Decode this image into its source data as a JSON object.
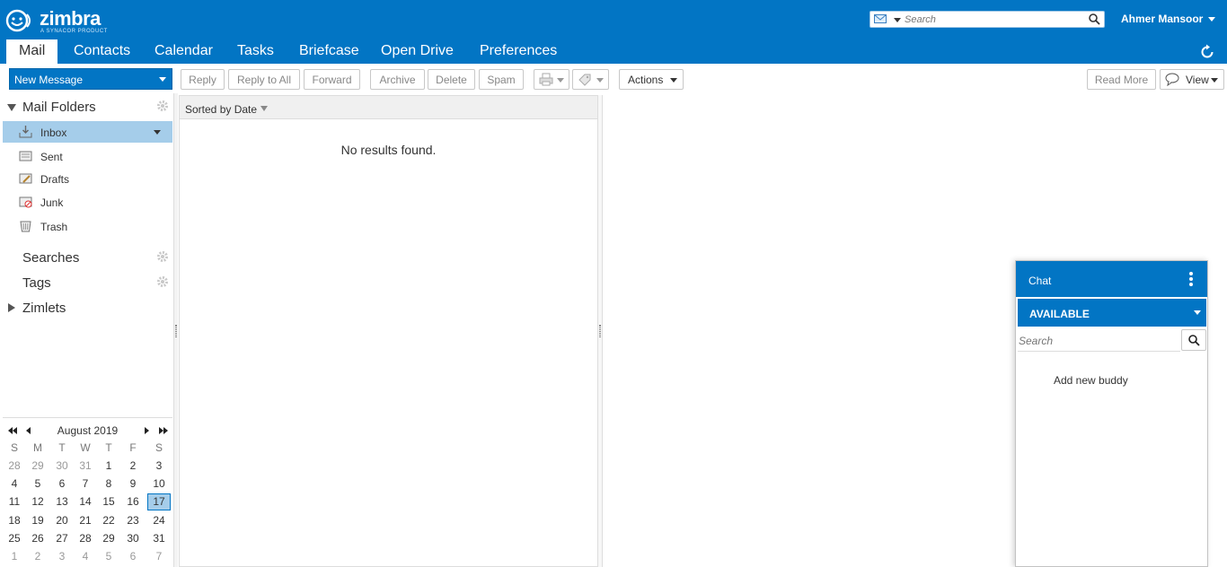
{
  "header": {
    "logo_text": "zimbra",
    "logo_tagline": "A SYNACOR PRODUCT",
    "search_placeholder": "Search",
    "user_name": "Ahmer Mansoor",
    "brand_color": "#0275c4"
  },
  "tabs": [
    {
      "label": "Mail",
      "active": true
    },
    {
      "label": "Contacts"
    },
    {
      "label": "Calendar"
    },
    {
      "label": "Tasks"
    },
    {
      "label": "Briefcase"
    },
    {
      "label": "Open Drive"
    },
    {
      "label": "Preferences"
    }
  ],
  "toolbar": {
    "new_message": "New Message",
    "reply": "Reply",
    "reply_all": "Reply to All",
    "forward": "Forward",
    "archive": "Archive",
    "delete": "Delete",
    "spam": "Spam",
    "actions": "Actions",
    "read_more": "Read More",
    "view": "View"
  },
  "sidebar": {
    "mail_folders": "Mail Folders",
    "folders": [
      {
        "label": "Inbox",
        "icon": "inbox-icon",
        "selected": true
      },
      {
        "label": "Sent",
        "icon": "sent-icon"
      },
      {
        "label": "Drafts",
        "icon": "drafts-icon"
      },
      {
        "label": "Junk",
        "icon": "junk-icon"
      },
      {
        "label": "Trash",
        "icon": "trash-icon"
      }
    ],
    "searches": "Searches",
    "tags": "Tags",
    "zimlets": "Zimlets"
  },
  "calendar": {
    "month_label": "August 2019",
    "weekdays": [
      "S",
      "M",
      "T",
      "W",
      "T",
      "F",
      "S"
    ],
    "weeks": [
      [
        "28",
        "29",
        "30",
        "31",
        "1",
        "2",
        "3"
      ],
      [
        "4",
        "5",
        "6",
        "7",
        "8",
        "9",
        "10"
      ],
      [
        "11",
        "12",
        "13",
        "14",
        "15",
        "16",
        "17"
      ],
      [
        "18",
        "19",
        "20",
        "21",
        "22",
        "23",
        "24"
      ],
      [
        "25",
        "26",
        "27",
        "28",
        "29",
        "30",
        "31"
      ],
      [
        "1",
        "2",
        "3",
        "4",
        "5",
        "6",
        "7"
      ]
    ],
    "today": "17"
  },
  "message_list": {
    "sort_label": "Sorted by Date",
    "empty_text": "No results found."
  },
  "chat": {
    "title": "Chat",
    "status": "AVAILABLE",
    "search_placeholder": "Search",
    "add_buddy": "Add new buddy"
  }
}
